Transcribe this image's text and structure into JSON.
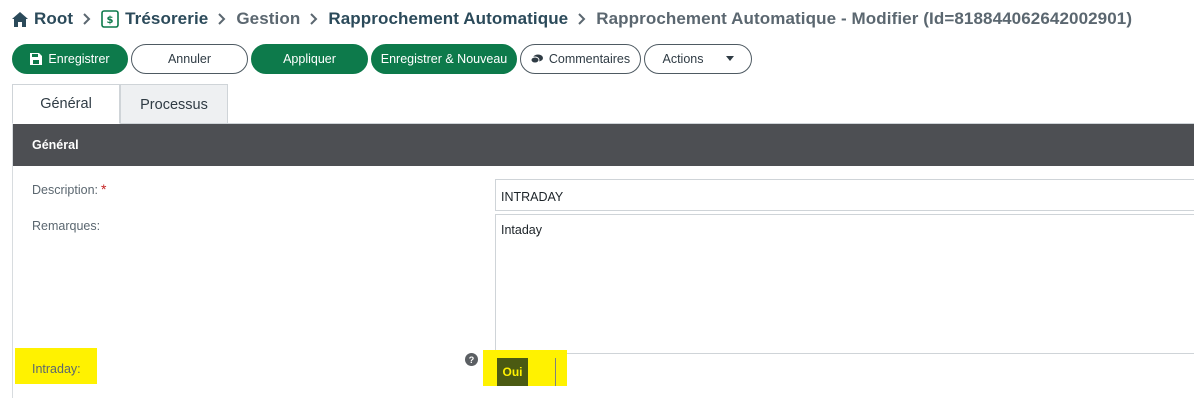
{
  "breadcrumb": {
    "items": [
      {
        "label": "Root",
        "icon": "home-icon"
      },
      {
        "label": "Trésorerie",
        "icon": "treasury-icon"
      },
      {
        "label": "Gestion"
      },
      {
        "label": "Rapprochement Automatique"
      },
      {
        "label": "Rapprochement Automatique - Modifier (Id=818844062642002901)"
      }
    ]
  },
  "toolbar": {
    "save_label": "Enregistrer",
    "cancel_label": "Annuler",
    "apply_label": "Appliquer",
    "save_new_label": "Enregistrer & Nouveau",
    "comments_label": "Commentaires",
    "actions_label": "Actions"
  },
  "tabs": [
    {
      "label": "Général",
      "active": true
    },
    {
      "label": "Processus",
      "active": false
    }
  ],
  "section": {
    "title": "Général"
  },
  "form": {
    "description": {
      "label": "Description:",
      "required_mark": "*",
      "value": "INTRADAY"
    },
    "remarques": {
      "label": "Remarques:",
      "value": "Intaday"
    },
    "intraday": {
      "label": "Intraday:",
      "help": "?",
      "value": "Oui"
    }
  },
  "colors": {
    "primary_green": "#0d7a4b",
    "breadcrumb_text": "#2b4a5a",
    "section_header": "#4d4f53",
    "highlight": "#fff200",
    "required": "#c42222"
  }
}
